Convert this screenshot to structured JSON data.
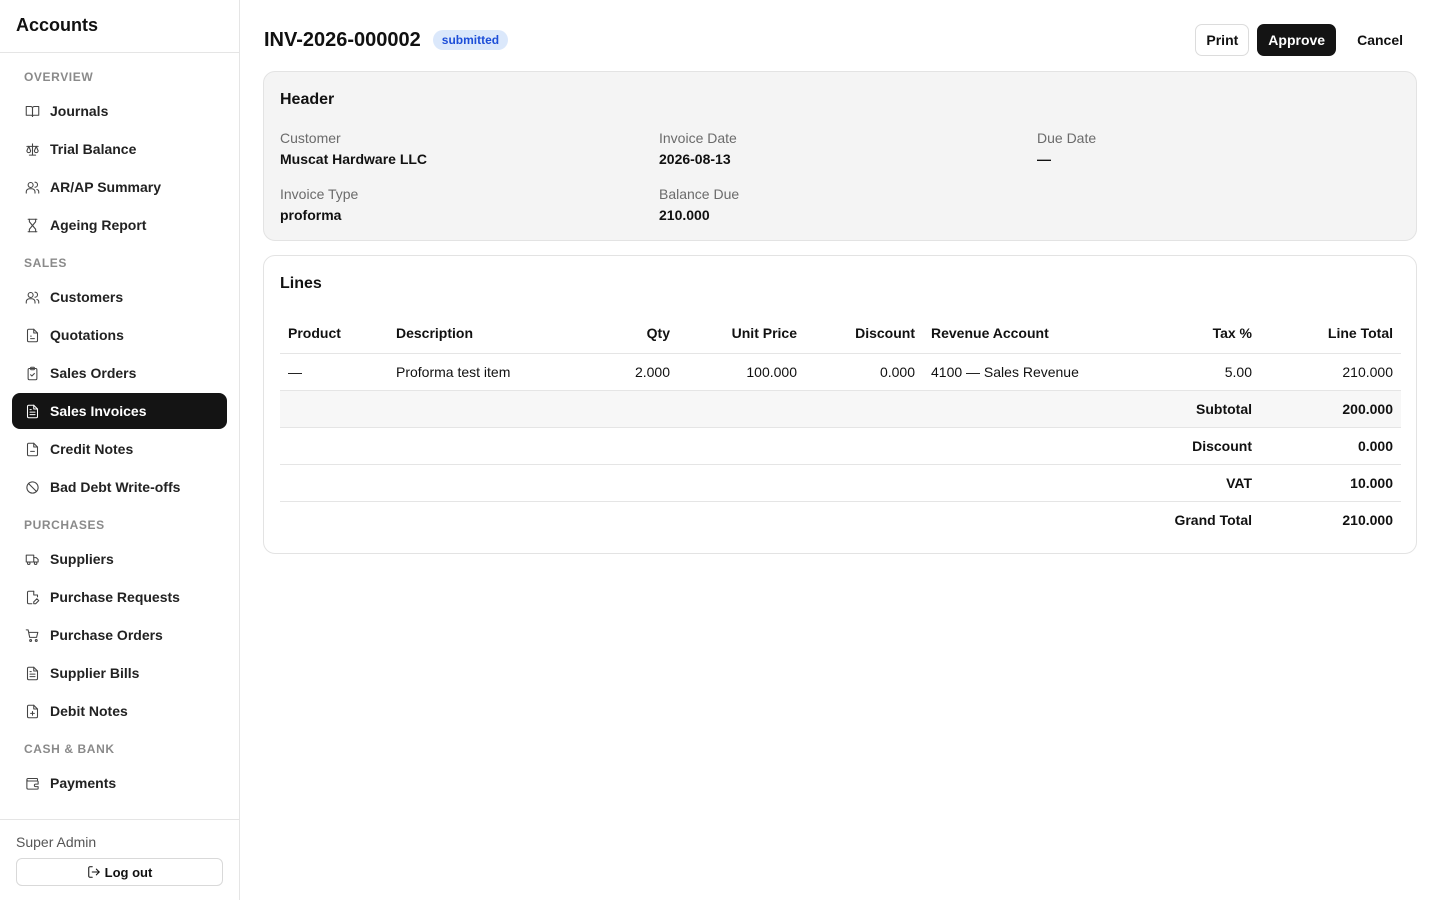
{
  "app": {
    "title": "Accounts"
  },
  "sidebar": {
    "sections": [
      {
        "label": "OVERVIEW",
        "items": [
          {
            "label": "Journals",
            "icon": "book-open-icon"
          },
          {
            "label": "Trial Balance",
            "icon": "scale-icon"
          },
          {
            "label": "AR/AP Summary",
            "icon": "users-icon"
          },
          {
            "label": "Ageing Report",
            "icon": "hourglass-icon"
          }
        ]
      },
      {
        "label": "SALES",
        "items": [
          {
            "label": "Customers",
            "icon": "users-icon"
          },
          {
            "label": "Quotations",
            "icon": "file-icon"
          },
          {
            "label": "Sales Orders",
            "icon": "clipboard-check-icon"
          },
          {
            "label": "Sales Invoices",
            "icon": "file-text-icon",
            "active": true
          },
          {
            "label": "Credit Notes",
            "icon": "file-minus-icon"
          },
          {
            "label": "Bad Debt Write-offs",
            "icon": "ban-icon"
          }
        ]
      },
      {
        "label": "PURCHASES",
        "items": [
          {
            "label": "Suppliers",
            "icon": "truck-icon"
          },
          {
            "label": "Purchase Requests",
            "icon": "file-edit-icon"
          },
          {
            "label": "Purchase Orders",
            "icon": "cart-icon"
          },
          {
            "label": "Supplier Bills",
            "icon": "file-text-icon"
          },
          {
            "label": "Debit Notes",
            "icon": "file-plus-icon"
          }
        ]
      },
      {
        "label": "CASH & BANK",
        "items": [
          {
            "label": "Payments",
            "icon": "wallet-icon"
          }
        ]
      }
    ],
    "user": "Super Admin",
    "logout_label": "Log out"
  },
  "document": {
    "number": "INV-2026-000002",
    "status": "submitted",
    "actions": {
      "print": "Print",
      "approve": "Approve",
      "cancel": "Cancel"
    }
  },
  "header_card": {
    "title": "Header",
    "fields": {
      "customer": {
        "label": "Customer",
        "value": "Muscat Hardware LLC"
      },
      "invoice_date": {
        "label": "Invoice Date",
        "value": "2026-08-13"
      },
      "due_date": {
        "label": "Due Date",
        "value": "—"
      },
      "invoice_type": {
        "label": "Invoice Type",
        "value": "proforma"
      },
      "balance_due": {
        "label": "Balance Due",
        "value": "210.000"
      }
    }
  },
  "lines_card": {
    "title": "Lines",
    "columns": [
      "Product",
      "Description",
      "Qty",
      "Unit Price",
      "Discount",
      "Revenue Account",
      "Tax %",
      "Line Total"
    ],
    "rows": [
      {
        "product": "—",
        "description": "Proforma test item",
        "qty": "2.000",
        "unit_price": "100.000",
        "discount": "0.000",
        "revenue_account": "4100 — Sales Revenue",
        "tax": "5.00",
        "line_total": "210.000"
      }
    ],
    "totals": [
      {
        "label": "Subtotal",
        "value": "200.000"
      },
      {
        "label": "Discount",
        "value": "0.000"
      },
      {
        "label": "VAT",
        "value": "10.000"
      },
      {
        "label": "Grand Total",
        "value": "210.000"
      }
    ]
  }
}
